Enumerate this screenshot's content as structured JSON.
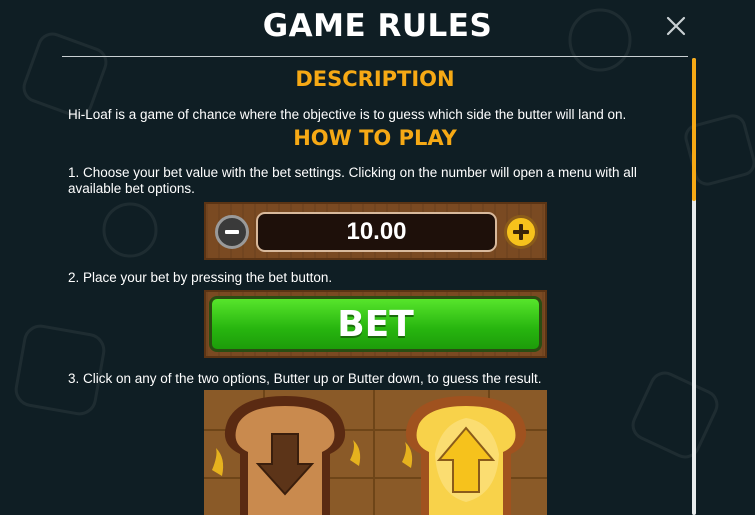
{
  "header": {
    "title": "GAME RULES",
    "close_icon": "close-icon"
  },
  "description": {
    "heading": "DESCRIPTION",
    "text": "Hi-Loaf is a game of chance where the objective is to guess which side the butter will land on."
  },
  "how_to_play": {
    "heading": "HOW TO PLAY",
    "step1": "1. Choose your bet value with the bet settings. Clicking on the number will open a menu with all available bet options.",
    "bet_value": "10.00",
    "step2": "2. Place your bet by pressing the bet button.",
    "bet_label": "BET",
    "step3": "3. Click on any of the two options, Butter up or Butter down, to guess the result."
  },
  "colors": {
    "accent": "#f6a915",
    "background": "#0f1e24",
    "bet_green": "#27b50f",
    "wood": "#7a4a22"
  },
  "icons": {
    "minus": "minus-icon",
    "plus": "plus-icon",
    "butter_down": "butter-down-toast-icon",
    "butter_up": "butter-up-toast-icon"
  }
}
